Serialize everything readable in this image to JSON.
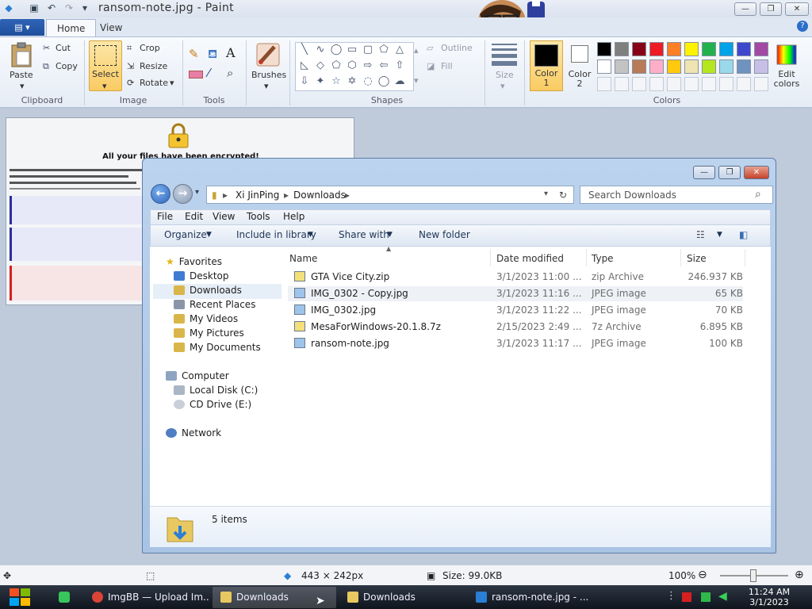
{
  "paint": {
    "title": "ransom-note.jpg - Paint",
    "tabs": {
      "file": "",
      "home": "Home",
      "view": "View"
    },
    "clipboard": {
      "paste": "Paste",
      "cut": "Cut",
      "copy": "Copy",
      "label": "Clipboard"
    },
    "image": {
      "select": "Select",
      "crop": "Crop",
      "resize": "Resize",
      "rotate": "Rotate",
      "label": "Image"
    },
    "tools": {
      "label": "Tools"
    },
    "brushes": "Brushes",
    "shapes": {
      "outline": "Outline",
      "fill": "Fill",
      "label": "Shapes"
    },
    "size": "Size",
    "color1": "Color 1",
    "color2": "Color 2",
    "colors_label": "Colors",
    "edit_colors": "Edit colors",
    "palette": [
      "#000000",
      "#7f7f7f",
      "#880015",
      "#ed1c24",
      "#ff7f27",
      "#fff200",
      "#22b14c",
      "#00a2e8",
      "#3f48cc",
      "#a349a4",
      "#ffffff",
      "#c3c3c3",
      "#b97a57",
      "#ffaec9",
      "#ffc90e",
      "#efe4b0",
      "#b5e61d",
      "#99d9ea",
      "#7092be",
      "#c8bfe7"
    ],
    "status": {
      "dimensions": "443 × 242px",
      "size": "Size: 99.0KB",
      "zoom": "100%"
    }
  },
  "note": {
    "heading": "All your files have been encrypted!"
  },
  "explorer": {
    "breadcrumb": [
      "Xi JinPing",
      "Downloads"
    ],
    "search_placeholder": "Search Downloads",
    "menu": [
      "File",
      "Edit",
      "View",
      "Tools",
      "Help"
    ],
    "commands": {
      "organize": "Organize",
      "include": "Include in library",
      "share": "Share with",
      "new_folder": "New folder"
    },
    "nav": {
      "favorites": "Favorites",
      "desktop": "Desktop",
      "downloads": "Downloads",
      "recent": "Recent Places",
      "videos": "My Videos",
      "pictures": "My Pictures",
      "documents": "My Documents",
      "computer": "Computer",
      "local_disk": "Local Disk (C:)",
      "cd_drive": "CD Drive (E:)",
      "network": "Network"
    },
    "columns": {
      "name": "Name",
      "date": "Date modified",
      "type": "Type",
      "size": "Size"
    },
    "files": [
      {
        "name": "GTA Vice City.zip",
        "date": "3/1/2023 11:00 ...",
        "type": "zip Archive",
        "size": "246.937 KB"
      },
      {
        "name": "IMG_0302 - Copy.jpg",
        "date": "3/1/2023 11:16 ...",
        "type": "JPEG image",
        "size": "65 KB"
      },
      {
        "name": "IMG_0302.jpg",
        "date": "3/1/2023 11:22 ...",
        "type": "JPEG image",
        "size": "70 KB"
      },
      {
        "name": "MesaForWindows-20.1.8.7z",
        "date": "2/15/2023 2:49 ...",
        "type": "7z Archive",
        "size": "6.895 KB"
      },
      {
        "name": "ransom-note.jpg",
        "date": "3/1/2023 11:17 ...",
        "type": "JPEG image",
        "size": "100 KB"
      }
    ],
    "item_count": "5 items"
  },
  "taskbar": {
    "tasks": [
      "ImgBB — Upload Im...",
      "Downloads",
      "Downloads",
      "ransom-note.jpg - ..."
    ],
    "time": "11:24 AM",
    "date": "3/1/2023"
  }
}
